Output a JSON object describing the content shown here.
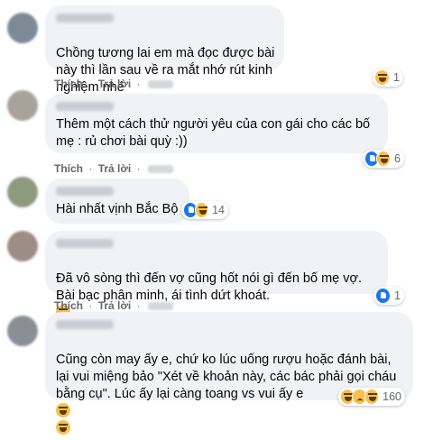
{
  "actions": {
    "like": "Thích",
    "reply": "Trả lời",
    "sep": "·"
  },
  "comments": [
    {
      "text": "Chồng tương lai em mà đọc được bài này thì lần sau về ra mắt nhớ rút kinh nghiệm nhé",
      "trailing_emoji": "rofl-icon",
      "reactions": [
        "haha"
      ],
      "count": "1"
    },
    {
      "text": "Thêm một cách thử người yêu của con gái cho các bố mẹ : rủ chơi bài quỳ :))",
      "reactions": [
        "like",
        "haha"
      ],
      "count": "6"
    },
    {
      "text": "Hài nhất vịnh Bắc Bộ",
      "reactions": [
        "like",
        "haha"
      ],
      "count": "14"
    },
    {
      "text": "Đã vô sòng thì đến vợ cũng hốt nói gì đến bố mẹ vợ. Bài bạc phân minh, ái tình dứt khoát.",
      "trailing_emoji": "grin-sweat-icon",
      "reactions": [
        "like"
      ],
      "count": "1"
    },
    {
      "text": "Cũng còn may ấy e, chứ ko lúc uống rượu hoặc đánh bài, lại vui miệng bảo \"Xét về khoản này, các bác phải gọi cháu bằng cụ\". Lúc ấy lại càng toang vs vui ấy e",
      "trailing_emoji": "grin-sweat-icon",
      "reactions": [
        "haha",
        "sad",
        "haha"
      ],
      "count": "160"
    }
  ]
}
